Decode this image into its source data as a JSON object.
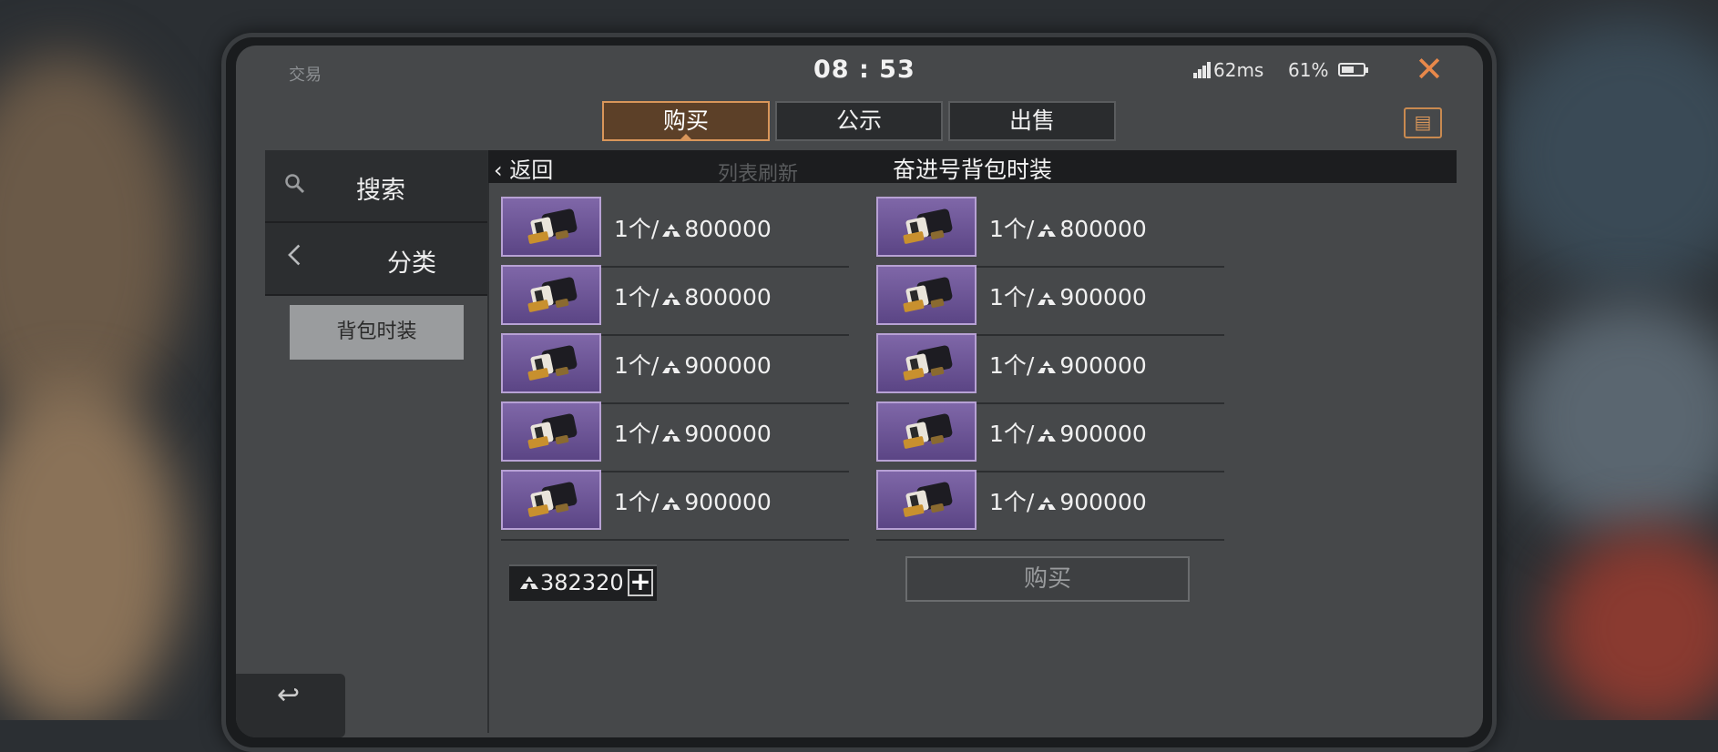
{
  "status": {
    "app_title": "交易",
    "time": "08 : 53",
    "ping": "62ms",
    "battery": "61%",
    "battery_level": 0.61
  },
  "tabs": [
    {
      "label": "购买",
      "active": true
    },
    {
      "label": "公示",
      "active": false
    },
    {
      "label": "出售",
      "active": false
    }
  ],
  "sidebar": {
    "search_label": "搜索",
    "category_label": "分类",
    "subcategory_label": "背包时装"
  },
  "list": {
    "back_label": "返回",
    "title": "奋进号背包时装",
    "refresh_hint": "列表刷新"
  },
  "items": [
    {
      "qty": "1个/",
      "price": "800000"
    },
    {
      "qty": "1个/",
      "price": "800000"
    },
    {
      "qty": "1个/",
      "price": "800000"
    },
    {
      "qty": "1个/",
      "price": "900000"
    },
    {
      "qty": "1个/",
      "price": "900000"
    },
    {
      "qty": "1个/",
      "price": "900000"
    },
    {
      "qty": "1个/",
      "price": "900000"
    },
    {
      "qty": "1个/",
      "price": "900000"
    },
    {
      "qty": "1个/",
      "price": "900000"
    },
    {
      "qty": "1个/",
      "price": "900000"
    }
  ],
  "wallet": {
    "amount": "382320",
    "plus": "+"
  },
  "buy_button": "购买",
  "colors": {
    "accent": "#d9965a",
    "item_bg": "#6a5296",
    "item_border": "#b7a1d4"
  }
}
